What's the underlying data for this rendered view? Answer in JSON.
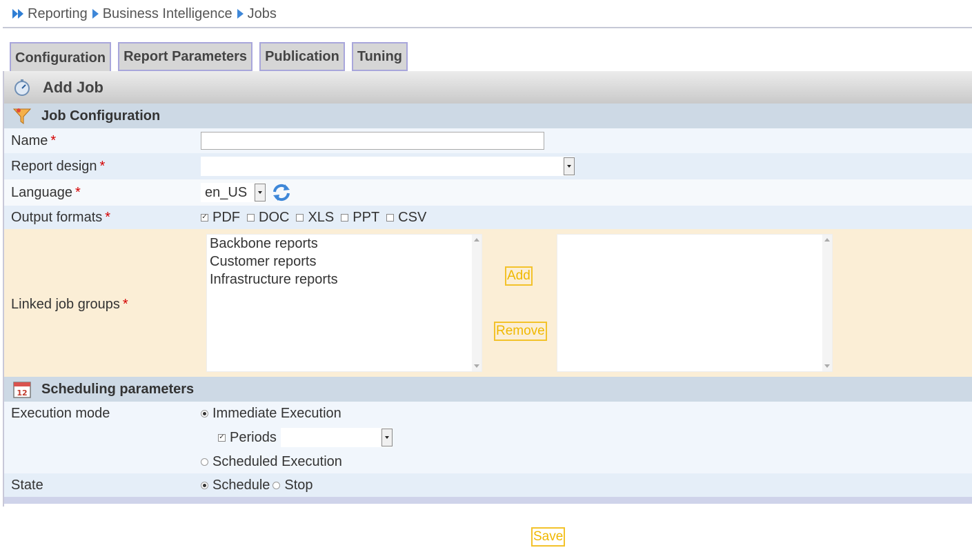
{
  "breadcrumb": [
    "Reporting",
    "Business Intelligence",
    "Jobs"
  ],
  "tabs": [
    {
      "label": "Configuration",
      "active": true
    },
    {
      "label": "Report Parameters",
      "active": false
    },
    {
      "label": "Publication",
      "active": false
    },
    {
      "label": "Tuning",
      "active": false
    }
  ],
  "panel": {
    "title": "Add Job"
  },
  "job_config": {
    "section_title": "Job Configuration",
    "name_label": "Name",
    "name_value": "",
    "report_design_label": "Report design",
    "report_design_value": "",
    "language_label": "Language",
    "language_value": "en_US",
    "output_formats_label": "Output formats",
    "formats": [
      {
        "label": "PDF",
        "checked": true
      },
      {
        "label": "DOC",
        "checked": false
      },
      {
        "label": "XLS",
        "checked": false
      },
      {
        "label": "PPT",
        "checked": false
      },
      {
        "label": "CSV",
        "checked": false
      }
    ],
    "linked_groups_label": "Linked job groups",
    "available_groups": [
      "Backbone reports",
      "Customer reports",
      "Infrastructure reports"
    ],
    "selected_groups": [],
    "add_label": "Add",
    "remove_label": "Remove",
    "required_mark": "*"
  },
  "scheduling": {
    "section_title": "Scheduling parameters",
    "execution_mode_label": "Execution mode",
    "immediate_label": "Immediate Execution",
    "immediate_selected": true,
    "periods_label": "Periods",
    "periods_checked": true,
    "periods_value": "",
    "scheduled_label": "Scheduled Execution",
    "scheduled_selected": false,
    "state_label": "State",
    "schedule_label": "Schedule",
    "schedule_selected": true,
    "stop_label": "Stop",
    "stop_selected": false
  },
  "save_label": "Save",
  "icons": {
    "breadcrumb_lead": "double-arrow-icon",
    "separator": "triangle-right-icon",
    "panel": "stopwatch-icon",
    "job_config": "funnel-icon",
    "scheduling": "calendar-icon",
    "language_refresh": "refresh-icon"
  },
  "colors": {
    "accent_blue": "#3e87d8",
    "tab_border": "#a8a6db",
    "section_bg": "#cdd9e5",
    "linked_groups_bg": "#fbeed6",
    "button_yellow": "#f3c22a",
    "required": "#d40000"
  }
}
